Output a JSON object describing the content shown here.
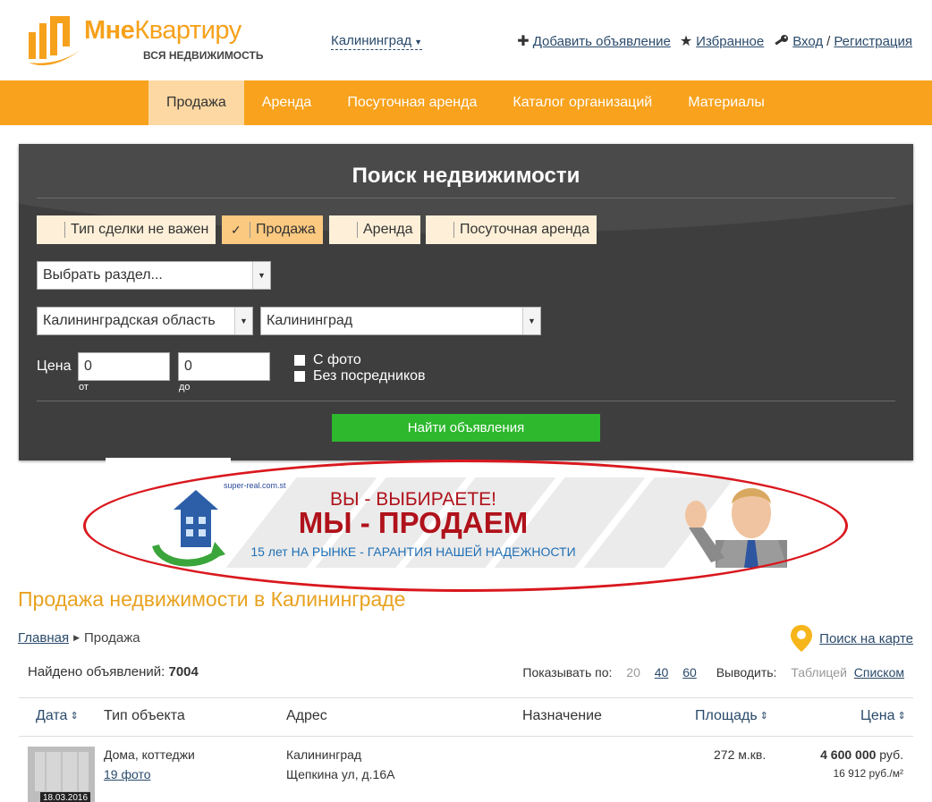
{
  "header": {
    "logo_name_part1": "Мне",
    "logo_name_part2": "Квартиру",
    "logo_sub": "ВСЯ НЕДВИЖИМОСТЬ",
    "city": "Калининград",
    "add_listing": "Добавить объявление",
    "favorites": "Избранное",
    "login": "Вход",
    "separator": "/",
    "register": "Регистрация"
  },
  "nav": {
    "items": [
      {
        "label": "Продажа"
      },
      {
        "label": "Аренда"
      },
      {
        "label": "Посуточная аренда"
      },
      {
        "label": "Каталог организаций"
      },
      {
        "label": "Материалы"
      }
    ]
  },
  "search": {
    "title": "Поиск недвижимости",
    "deal_types": [
      {
        "label": "Тип сделки не важен",
        "checked": false
      },
      {
        "label": "Продажа",
        "checked": true
      },
      {
        "label": "Аренда",
        "checked": false
      },
      {
        "label": "Посуточная аренда",
        "checked": false
      }
    ],
    "section_select": "Выбрать раздел...",
    "region_select": "Калининградская область",
    "city_select": "Калининград",
    "price_label": "Цена",
    "price_from": "0",
    "price_to": "0",
    "from_label": "от",
    "to_label": "до",
    "with_photo": "С фото",
    "no_agents": "Без посредников",
    "submit": "Найти объявления"
  },
  "banner": {
    "site": "super-real.com.st",
    "line1": "ВЫ - ВЫБИРАЕТЕ!",
    "line2": "МЫ - ПРОДАЕМ",
    "line3": "15 лет НА РЫНКЕ - ГАРАНТИЯ НАШЕЙ НАДЕЖНОСТИ"
  },
  "results": {
    "page_title": "Продажа недвижимости в Калининграде",
    "breadcrumb_home": "Главная",
    "breadcrumb_current": "Продажа",
    "map_search": "Поиск на карте",
    "found_label": "Найдено объявлений:",
    "found_count": "7004",
    "per_page_label": "Показывать по:",
    "per_page_options": [
      "20",
      "40",
      "60"
    ],
    "display_label": "Выводить:",
    "display_table": "Таблицей",
    "display_list": "Списком",
    "columns": {
      "date": "Дата",
      "type": "Тип объекта",
      "address": "Адрес",
      "purpose": "Назначение",
      "area": "Площадь",
      "price": "Цена"
    },
    "rows": [
      {
        "thumb_date": "18.03.2016",
        "type": "Дома, коттеджи",
        "photos": "19 фото",
        "city": "Калининград",
        "street": "Щепкина ул, д.16А",
        "area": "272 м.кв.",
        "price": "4 600 000",
        "currency": "руб.",
        "price_per_m": "16 912 руб./м²"
      }
    ]
  },
  "colors": {
    "accent": "#f8a21d",
    "nav_active": "#fdd8a2",
    "search_bg": "#3e3e3e",
    "button_green": "#2db82d",
    "banner_red": "#b0121b",
    "link": "#2a4a6b"
  }
}
